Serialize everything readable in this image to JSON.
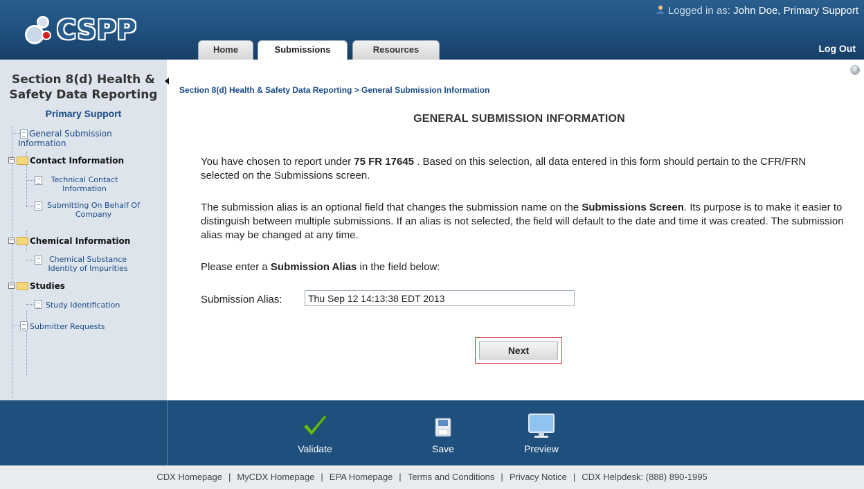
{
  "header": {
    "logo_text": "CSPP",
    "logged_in_prefix": "Logged in as:",
    "user": "John Doe, Primary Support",
    "logout": "Log Out",
    "tabs": [
      "Home",
      "Submissions",
      "Resources"
    ],
    "active_tab": "Submissions"
  },
  "sidebar": {
    "title_line1": "Section 8(d) Health &",
    "title_line2": "Safety Data Reporting",
    "role": "Primary Support",
    "items": {
      "general": [
        "General Submission",
        "Information"
      ],
      "contact_group": "Contact Information",
      "technical": [
        "Technical Contact",
        "Information"
      ],
      "behalf": [
        "Submitting On Behalf Of",
        "Company"
      ],
      "chemical_group": "Chemical Information",
      "substance": [
        "Chemical Substance",
        "Identity of Impurities"
      ],
      "studies_group": "Studies",
      "study_id": "Study Identification",
      "requests": "Submitter Requests"
    }
  },
  "main": {
    "breadcrumb": "Section 8(d) Health & Safety Data Reporting > General Submission Information",
    "title": "GENERAL SUBMISSION INFORMATION",
    "p1_a": "You have chosen to report under ",
    "p1_bold": "75 FR 17645",
    "p1_b": " . Based on this selection, all data entered in this form should pertain to the CFR/FRN selected on the Submissions screen.",
    "p2_a": "The submission alias is an optional field that changes the submission name on the ",
    "p2_bold": "Submissions Screen",
    "p2_b": ". Its purpose is to make it easier to distinguish between multiple submissions. If an alias is not selected, the field will default to the date and time it was created. The submission alias may be changed at any time.",
    "p3_a": "Please enter a ",
    "p3_bold": "Submission Alias",
    "p3_b": " in the field below:",
    "alias_label": "Submission Alias:",
    "alias_value": "Thu Sep 12 14:13:38 EDT 2013",
    "next_label": "Next"
  },
  "toolbar": {
    "validate": "Validate",
    "save": "Save",
    "preview": "Preview"
  },
  "footer_links": [
    "CDX Homepage",
    "MyCDX Homepage",
    "EPA Homepage",
    "Terms and Conditions",
    "Privacy Notice",
    "CDX Helpdesk: (888) 890-1995"
  ],
  "colors": {
    "brand_blue": "#1f4f7c",
    "link_blue": "#1a4a86",
    "sidebar_bg": "#dde4ec",
    "highlight_red": "#d03030",
    "validate_green": "#6cc21e"
  }
}
